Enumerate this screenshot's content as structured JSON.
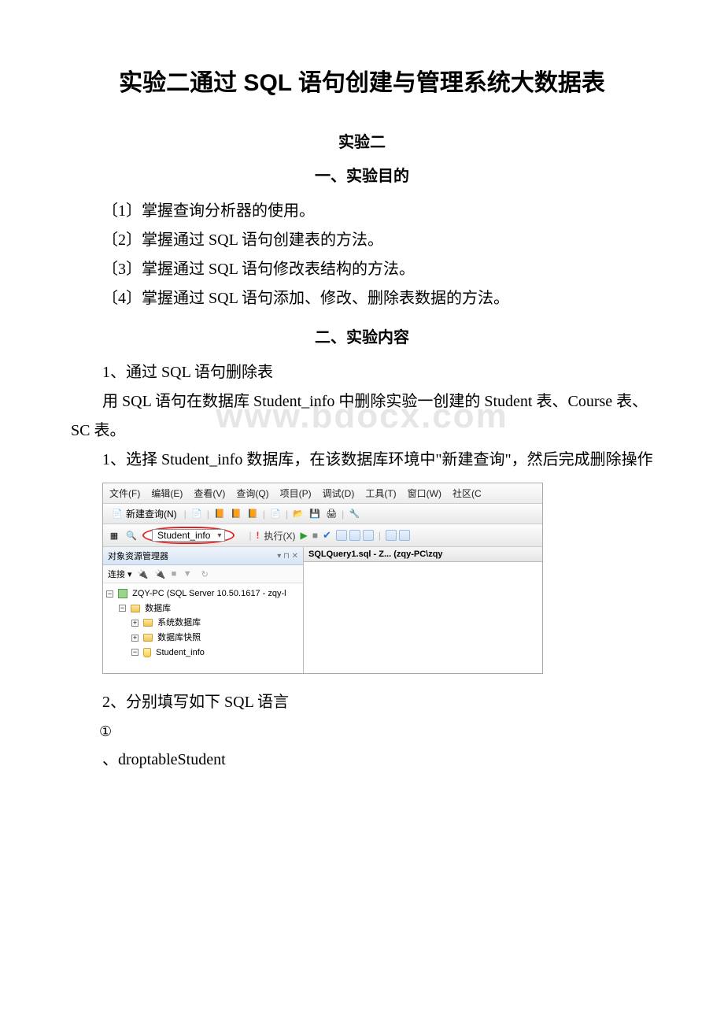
{
  "title": "实验二通过 SQL 语句创建与管理系统大数据表",
  "subtitle": "实验二",
  "section1": {
    "heading": "一、实验目的",
    "items": [
      "〔1〕掌握查询分析器的使用。",
      "〔2〕掌握通过 SQL 语句创建表的方法。",
      "〔3〕掌握通过 SQL 语句修改表结构的方法。",
      "〔4〕掌握通过 SQL 语句添加、修改、删除表数据的方法。"
    ]
  },
  "section2": {
    "heading": "二、实验内容",
    "p1": "1、通过 SQL 语句删除表",
    "p2": "用 SQL 语句在数据库 Student_info 中删除实验一创建的 Student 表、Course 表、SC 表。",
    "p3": "1、选择 Student_info 数据库，在该数据库环境中\"新建查询\"，然后完成删除操作",
    "p4": "2、分别填写如下 SQL 语言",
    "p5_circle": "①",
    "p5": "、droptableStudent"
  },
  "watermark": "www.bdocx.com",
  "ssms": {
    "menu": [
      "文件(F)",
      "编辑(E)",
      "查看(V)",
      "查询(Q)",
      "项目(P)",
      "调试(D)",
      "工具(T)",
      "窗口(W)",
      "社区(C"
    ],
    "new_query": "新建查询(N)",
    "db_selected": "Student_info",
    "execute": "执行(X)",
    "left_panel_title": "对象资源管理器",
    "connect_label": "连接 ▾",
    "tree": {
      "server": "ZQY-PC (SQL Server 10.50.1617 - zqy-l",
      "db_root": "数据库",
      "sys_db": "系统数据库",
      "db_snap": "数据库快照",
      "student_info": "Student_info"
    },
    "tab": "SQLQuery1.sql - Z... (zqy-PC\\zqy"
  }
}
